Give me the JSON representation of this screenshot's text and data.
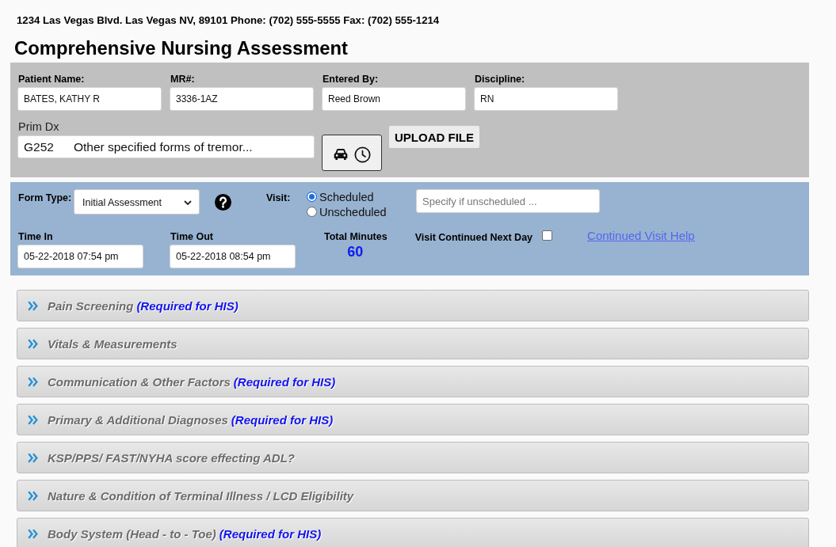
{
  "header": {
    "address": "1234 Las Vegas Blvd. Las Vegas NV, 89101 Phone: (702) 555-5555 Fax: (702) 555-1214"
  },
  "title": "Comprehensive Nursing Assessment",
  "patient_panel": {
    "fields": [
      {
        "label": "Patient Name:",
        "value": "BATES, KATHY R"
      },
      {
        "label": "MR#:",
        "value": "3336-1AZ"
      },
      {
        "label": "Entered By:",
        "value": "Reed Brown"
      },
      {
        "label": "Discipline:",
        "value": "RN"
      }
    ],
    "primary_diagnosis": {
      "label": "Prim Dx",
      "code": "G252",
      "description": "Other specified forms of tremor..."
    },
    "upload_button": {
      "label": "UPLOAD FILE"
    }
  },
  "visit_panel": {
    "form_type": {
      "label": "Form Type:",
      "value": "Initial Assessment"
    },
    "visit": {
      "label": "Visit:",
      "options": [
        {
          "label": "Scheduled",
          "selected": true
        },
        {
          "label": "Unscheduled",
          "selected": false
        }
      ],
      "reason": {
        "placeholder": "Specify if unscheduled ..."
      }
    },
    "time_in": {
      "label": "Time In",
      "value": "05-22-2018 07:54 pm"
    },
    "time_out": {
      "label": "Time Out",
      "value": "05-22-2018 08:54 pm"
    },
    "total_minutes": {
      "label": "Total Minutes",
      "value": "60"
    },
    "continued_next_day": {
      "label": "Visit Continued Next Day",
      "checked": false
    },
    "help_link": {
      "label": "Continued Visit Help"
    }
  },
  "sections": [
    {
      "title": "Pain Screening",
      "note": "(Required for HIS)"
    },
    {
      "title": "Vitals & Measurements"
    },
    {
      "title": "Communication & Other Factors",
      "note": "(Required for HIS)"
    },
    {
      "title": "Primary & Additional Diagnoses",
      "note": "(Required for HIS)"
    },
    {
      "title": "KSP/PPS/ FAST/NYHA score effecting ADL?"
    },
    {
      "title": "Nature & Condition of Terminal Illness / LCD Eligibility"
    },
    {
      "title": "Body System (Head - to - Toe)",
      "note": "(Required for HIS)"
    }
  ]
}
